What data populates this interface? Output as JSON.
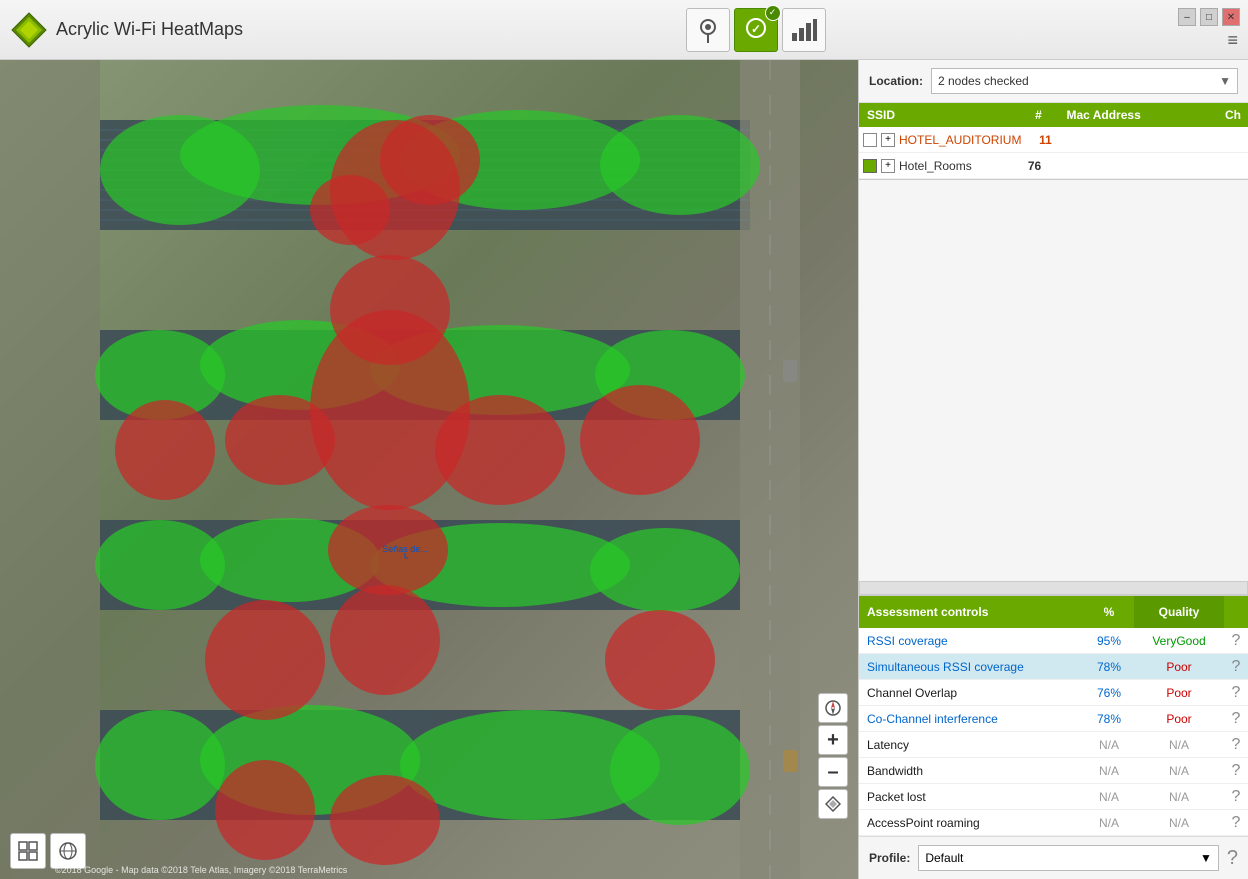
{
  "app": {
    "title": "Acrylic Wi-Fi HeatMaps"
  },
  "titlebar": {
    "win_controls": [
      "–",
      "□",
      "✕"
    ],
    "menu_icon": "≡",
    "toolbar": [
      {
        "icon": "📍",
        "label": "location-icon",
        "active": false
      },
      {
        "icon": "🏅",
        "label": "badge-icon",
        "active": true
      },
      {
        "icon": "📶",
        "label": "signal-icon",
        "active": false
      }
    ]
  },
  "right_panel": {
    "location_label": "Location:",
    "location_value": "2 nodes checked",
    "ssid_table": {
      "headers": [
        "SSID",
        "#",
        "Mac Address",
        "Ch"
      ],
      "rows": [
        {
          "name": "HOTEL_AUDITORIUM",
          "count": "11",
          "mac": "",
          "ch": "",
          "color": "white"
        },
        {
          "name": "Hotel_Rooms",
          "count": "76",
          "mac": "",
          "ch": "",
          "color": "#6aaa00"
        }
      ]
    },
    "assessment": {
      "headers": [
        "Assessment controls",
        "%",
        "Quality"
      ],
      "rows": [
        {
          "name": "RSSI coverage",
          "pct": "95%",
          "quality": "VeryGood",
          "quality_class": "verygood",
          "highlighted": false,
          "name_class": "blue"
        },
        {
          "name": "Simultaneous RSSI coverage",
          "pct": "78%",
          "quality": "Poor",
          "quality_class": "poor",
          "highlighted": true,
          "name_class": "blue"
        },
        {
          "name": "Channel Overlap",
          "pct": "76%",
          "quality": "Poor",
          "quality_class": "poor",
          "highlighted": false,
          "name_class": "normal"
        },
        {
          "name": "Co-Channel interference",
          "pct": "78%",
          "quality": "Poor",
          "quality_class": "poor",
          "highlighted": false,
          "name_class": "blue"
        },
        {
          "name": "Latency",
          "pct": "N/A",
          "quality": "N/A",
          "quality_class": "na",
          "highlighted": false,
          "name_class": "normal"
        },
        {
          "name": "Bandwidth",
          "pct": "N/A",
          "quality": "N/A",
          "quality_class": "na",
          "highlighted": false,
          "name_class": "normal"
        },
        {
          "name": "Packet lost",
          "pct": "N/A",
          "quality": "N/A",
          "quality_class": "na",
          "highlighted": false,
          "name_class": "normal"
        },
        {
          "name": "AccessPoint roaming",
          "pct": "N/A",
          "quality": "N/A",
          "quality_class": "na",
          "highlighted": false,
          "name_class": "normal"
        }
      ]
    },
    "profile_label": "Profile:",
    "profile_value": "Default"
  },
  "map": {
    "copyright": "©2018 Google - Map data ©2018 Tele Atlas, Imagery ©2018 TerraMetrics",
    "controls": [
      "+",
      "–",
      "⊙"
    ],
    "bottom_left_btns": [
      "⊞",
      "🌍"
    ]
  }
}
